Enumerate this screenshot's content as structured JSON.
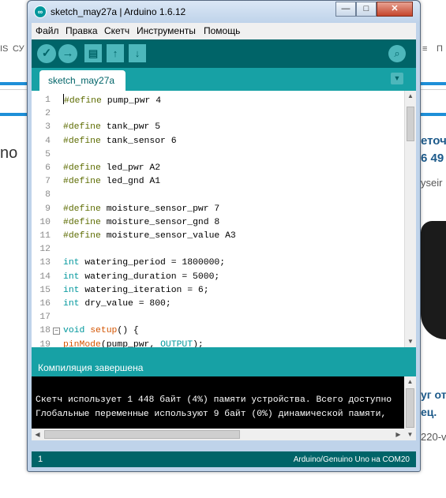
{
  "background_page": {
    "nav_left_1": "IS",
    "nav_left_2": "СУ",
    "nav_right_1": "≡",
    "nav_right_2": "П",
    "left_text": "no",
    "right_heading_1": "еточ",
    "right_heading_2": "6 49",
    "right_link": "yseir",
    "right_heading_3": "уг от",
    "right_heading_4": "ец.",
    "right_link_2": "220-v"
  },
  "window": {
    "title": "sketch_may27a | Arduino 1.6.12",
    "minimize": "—",
    "maximize": "□",
    "close": "✕"
  },
  "menu": {
    "items": [
      "Файл",
      "Правка",
      "Скетч",
      "Инструменты",
      "Помощь"
    ]
  },
  "toolbar": {
    "verify_icon": "✓",
    "upload_icon": "→",
    "new_icon": "▤",
    "open_icon": "↑",
    "save_icon": "↓",
    "serial_monitor_icon": "⌕"
  },
  "tabs": {
    "active": "sketch_may27a",
    "menu_icon": "▼"
  },
  "editor": {
    "lines": [
      {
        "n": "1",
        "text": "#define pump_pwr 4"
      },
      {
        "n": "2",
        "text": ""
      },
      {
        "n": "3",
        "text": "#define tank_pwr 5"
      },
      {
        "n": "4",
        "text": "#define tank_sensor 6"
      },
      {
        "n": "5",
        "text": ""
      },
      {
        "n": "6",
        "text": "#define led_pwr A2"
      },
      {
        "n": "7",
        "text": "#define led_gnd A1"
      },
      {
        "n": "8",
        "text": ""
      },
      {
        "n": "9",
        "text": "#define moisture_sensor_pwr 7"
      },
      {
        "n": "10",
        "text": "#define moisture_sensor_gnd 8"
      },
      {
        "n": "11",
        "text": "#define moisture_sensor_value A3"
      },
      {
        "n": "12",
        "text": ""
      },
      {
        "n": "13",
        "text": "int watering_period = 1800000;"
      },
      {
        "n": "14",
        "text": "int watering_duration = 5000;"
      },
      {
        "n": "15",
        "text": "int watering_iteration = 6;"
      },
      {
        "n": "16",
        "text": "int dry_value = 800;"
      },
      {
        "n": "17",
        "text": ""
      },
      {
        "n": "18",
        "text": "void setup() {"
      },
      {
        "n": "19",
        "text": "pinMode(pump_pwr, OUTPUT);"
      }
    ]
  },
  "status": {
    "message": "Компиляция завершена"
  },
  "console": {
    "line1": "Скетч использует 1 448 байт (4%) памяти устройства. Всего доступно",
    "line2": "Глобальные переменные используют 9 байт (0%) динамической памяти,"
  },
  "footer": {
    "line_number": "1",
    "board": "Arduino/Genuino Uno на COM20"
  }
}
